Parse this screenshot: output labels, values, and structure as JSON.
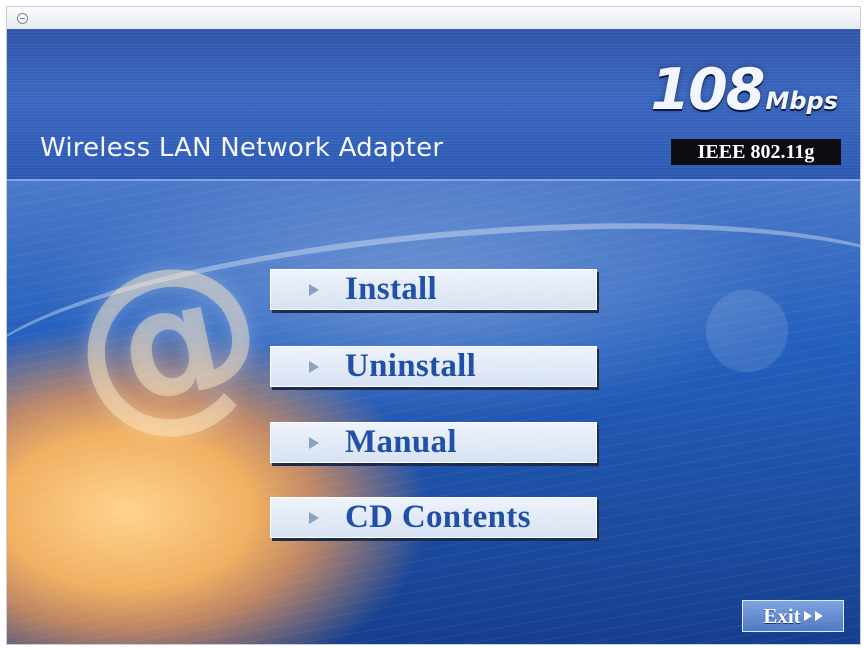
{
  "header": {
    "brand_number": "108",
    "brand_unit": "Mbps",
    "product_name": "Wireless LAN Network Adapter",
    "standard": "IEEE 802.11g"
  },
  "menu": {
    "items": [
      {
        "label": "Install"
      },
      {
        "label": "Uninstall"
      },
      {
        "label": "Manual"
      },
      {
        "label": "CD Contents"
      }
    ],
    "exit_label": "Exit"
  },
  "colors": {
    "header_blue": "#2f53a8",
    "button_text": "#1f4fa7",
    "exit_blue": "#4f79c2"
  },
  "icons": [
    "window-icon",
    "arrow-right-icon",
    "double-arrow-icon"
  ]
}
